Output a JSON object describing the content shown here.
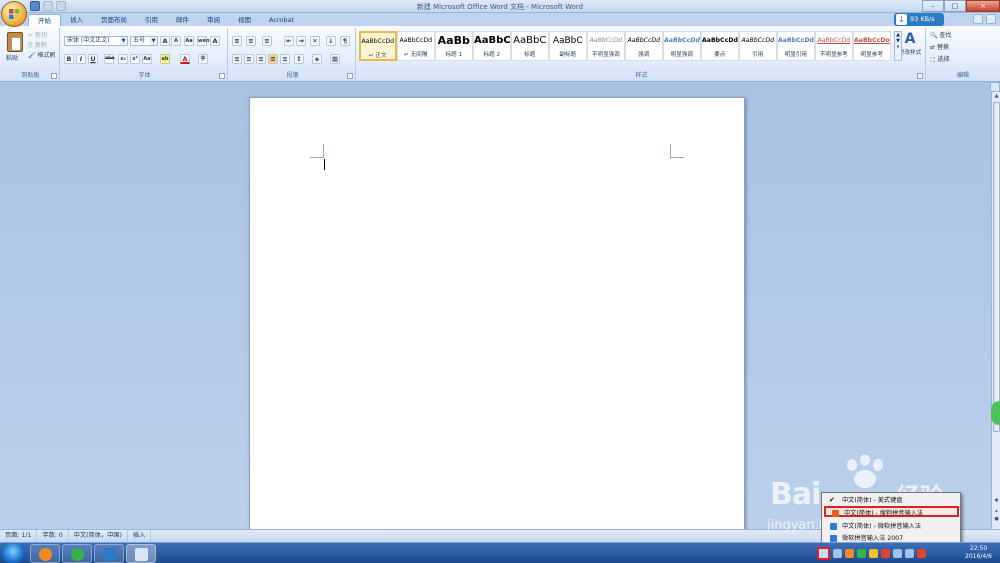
{
  "window": {
    "title": "新建 Microsoft Office Word 文档 - Microsoft Word",
    "controls": [
      "–",
      "□",
      "×"
    ]
  },
  "tabs": [
    {
      "label": "开始",
      "active": true
    },
    {
      "label": "插入"
    },
    {
      "label": "页面布局"
    },
    {
      "label": "引用"
    },
    {
      "label": "邮件"
    },
    {
      "label": "审阅"
    },
    {
      "label": "视图"
    },
    {
      "label": "Acrobat"
    }
  ],
  "network_badge": {
    "speed": "93 KB/s"
  },
  "clipboard": {
    "paste": "粘贴",
    "cut": "剪切",
    "copy": "复制",
    "format_painter": "格式刷",
    "label": "剪贴板"
  },
  "font": {
    "family": "宋体 (中文正文)",
    "size": "五号",
    "label": "字体",
    "buttons": {
      "grow": "A",
      "shrink": "A",
      "clear": "Aa",
      "phonetic": "wén",
      "enclose": "A",
      "bold": "B",
      "italic": "I",
      "underline": "U",
      "strike": "abe",
      "sub": "x₂",
      "sup": "x²",
      "case": "Aa",
      "highlight": "ab",
      "color": "A",
      "circled": "字"
    }
  },
  "paragraph": {
    "label": "段落"
  },
  "styles": {
    "label": "样式",
    "items": [
      {
        "sample": "AaBbCcDd",
        "name": "↵ 正文",
        "selected": true
      },
      {
        "sample": "AaBbCcDd",
        "name": "↵ 无间隔"
      },
      {
        "sample": "AaBb",
        "name": "标题 1"
      },
      {
        "sample": "AaBbC",
        "name": "标题 2"
      },
      {
        "sample": "AaBbC",
        "name": "标题"
      },
      {
        "sample": "AaBbC",
        "name": "副标题"
      },
      {
        "sample": "AaBbCcDd",
        "name": "不明显强调"
      },
      {
        "sample": "AaBbCcDd",
        "name": "强调"
      },
      {
        "sample": "AaBbCcDd",
        "name": "明显强调"
      },
      {
        "sample": "AaBbCcDd",
        "name": "要点"
      },
      {
        "sample": "AaBbCcDd",
        "name": "引用"
      },
      {
        "sample": "AaBbCcDd",
        "name": "明显引用"
      },
      {
        "sample": "AaBbCcDd",
        "name": "不明显参考"
      },
      {
        "sample": "AaBbCcDo",
        "name": "明显参考"
      }
    ],
    "change_styles": "更改样式"
  },
  "editing": {
    "find": "查找",
    "replace": "替换",
    "select": "选择",
    "label": "编辑"
  },
  "status": {
    "page": "页面: 1/1",
    "words": "字数: 0",
    "language": "中文(简体，中国)",
    "mode": "插入"
  },
  "ime_menu": {
    "items": [
      {
        "label": "中文(简体) - 美式键盘",
        "checked": true
      },
      {
        "label": "中文(简体) - 搜狗拼音输入法",
        "highlighted": true
      },
      {
        "label": "中文(简体) - 微软拼音输入法"
      },
      {
        "label": "微软拼音输入法 2007"
      }
    ]
  },
  "clock": {
    "time": "22:50",
    "date": "2016/4/6"
  },
  "watermark": {
    "brand": "Bai",
    "brand_suffix": "经验",
    "url": "jingyan.baidu.com"
  }
}
